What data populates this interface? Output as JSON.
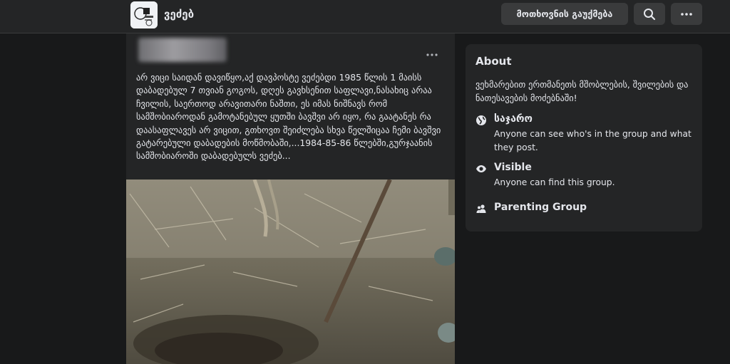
{
  "header": {
    "group_name": "ვეძებ",
    "invite_label": "მოთხოვნის გაუქმება",
    "search_icon": "search-icon",
    "more_icon": "more-dots-icon"
  },
  "post": {
    "more_icon": "more-dots-icon",
    "text": "არ ვიცი საიდან დავიწყო,აქ დავპოსტე ვეძებდი 1985 წლის 1 მაისს დაბადებულ 7 თვიან გოგოს, დღეს გავხსენით საფლავი,ნასახიც არაა ჩვილის, საერთოდ არავითარი ნაშთი, ეს იმას ნიშნავს რომ სამშობიაროდან გამოტანებულ ყუთში ბავშვი არ იყო, რა გაატანეს რა დაასაფლავეს არ ვიცით, გთხოვთ შეიძლება სხვა წელშიცაა ჩემი ბავშვი გატარებული დაბადების მოწმობაში,...1984-85-86 წლებში,გურჯაანის სამშობიაროში დაბადებულს ვეძებ..."
  },
  "about": {
    "title": "About",
    "description": "ვეხმარებით ერთმანეთს მშობლების, შვილების და ნათესავების მოძებნაში!",
    "privacy": {
      "icon": "globe-icon",
      "title": "საჯარო",
      "subtitle": "Anyone can see who's in the group and what they post."
    },
    "visibility": {
      "icon": "eye-icon",
      "title": "Visible",
      "subtitle": "Anyone can find this group."
    },
    "type": {
      "icon": "people-icon",
      "title": "Parenting Group"
    }
  },
  "colors": {
    "background": "#18191a",
    "card": "#242526",
    "button": "#3a3b3c",
    "text": "#e4e6eb"
  }
}
